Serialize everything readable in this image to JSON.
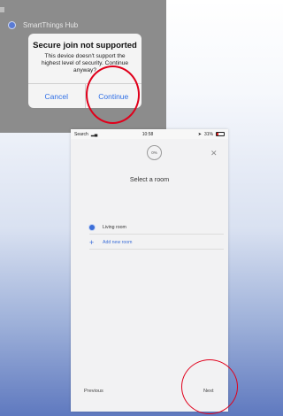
{
  "screen_one": {
    "list_item": "SmartThings Hub",
    "dialog": {
      "title": "Secure join not supported",
      "body": "This device doesn't support the highest level of security. Continue anyway?",
      "cancel": "Cancel",
      "continue": "Continue"
    }
  },
  "screen_two": {
    "status": {
      "carrier": "Search",
      "time": "10:58",
      "battery": "31%"
    },
    "progress": "0%",
    "title": "Select a room",
    "rooms": [
      {
        "label": "Living room",
        "selected": true
      }
    ],
    "add_room": "Add new room",
    "previous": "Previous",
    "next": "Next"
  },
  "colors": {
    "accent": "#3c6ed8",
    "highlight_ring": "#e0001b",
    "ios_blue": "#2f6fe6"
  }
}
